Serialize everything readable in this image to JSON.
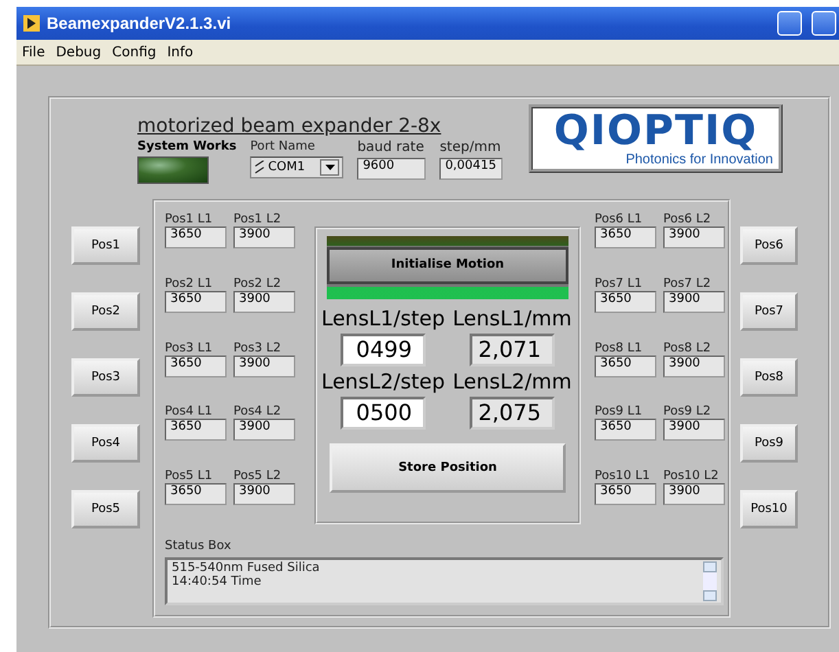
{
  "window": {
    "title": "BeamexpanderV2.1.3.vi"
  },
  "menu": [
    "File",
    "Debug",
    "Config",
    "Info"
  ],
  "header": {
    "title": "motorized beam expander 2-8x",
    "indicator_label": "System Works",
    "port": {
      "label": "Port Name",
      "value": "COM1"
    },
    "baud": {
      "label": "baud rate",
      "value": "9600"
    },
    "step": {
      "label": "step/mm",
      "value": "0,00415"
    }
  },
  "logo": {
    "name": "QIOPTIQ",
    "tagline": "Photonics for Innovation"
  },
  "positions": [
    {
      "button": "Pos1",
      "label_l1": "Pos1 L1",
      "label_l2": "Pos1 L2",
      "l1": "3650",
      "l2": "3900"
    },
    {
      "button": "Pos2",
      "label_l1": "Pos2 L1",
      "label_l2": "Pos2 L2",
      "l1": "3650",
      "l2": "3900"
    },
    {
      "button": "Pos3",
      "label_l1": "Pos3 L1",
      "label_l2": "Pos3 L2",
      "l1": "3650",
      "l2": "3900"
    },
    {
      "button": "Pos4",
      "label_l1": "Pos4 L1",
      "label_l2": "Pos4 L2",
      "l1": "3650",
      "l2": "3900"
    },
    {
      "button": "Pos5",
      "label_l1": "Pos5 L1",
      "label_l2": "Pos5 L2",
      "l1": "3650",
      "l2": "3900"
    },
    {
      "button": "Pos6",
      "label_l1": "Pos6 L1",
      "label_l2": "Pos6 L2",
      "l1": "3650",
      "l2": "3900"
    },
    {
      "button": "Pos7",
      "label_l1": "Pos7 L1",
      "label_l2": "Pos7 L2",
      "l1": "3650",
      "l2": "3900"
    },
    {
      "button": "Pos8",
      "label_l1": "Pos8 L1",
      "label_l2": "Pos8 L2",
      "l1": "3650",
      "l2": "3900"
    },
    {
      "button": "Pos9",
      "label_l1": "Pos9 L1",
      "label_l2": "Pos9 L2",
      "l1": "3650",
      "l2": "3900"
    },
    {
      "button": "Pos10",
      "label_l1": "Pos10 L1",
      "label_l2": "Pos10 L2",
      "l1": "3650",
      "l2": "3900"
    }
  ],
  "motion": {
    "init_button": "Initialise Motion",
    "store_button": "Store Position",
    "lenses": [
      {
        "step_label": "LensL1/step",
        "mm_label": "LensL1/mm",
        "step": "0499",
        "mm": "2,071"
      },
      {
        "step_label": "LensL2/step",
        "mm_label": "LensL2/mm",
        "step": "0500",
        "mm": "2,075"
      }
    ]
  },
  "status": {
    "label": "Status Box",
    "lines": [
      "515-540nm Fused Silica",
      "14:40:54 Time"
    ]
  }
}
